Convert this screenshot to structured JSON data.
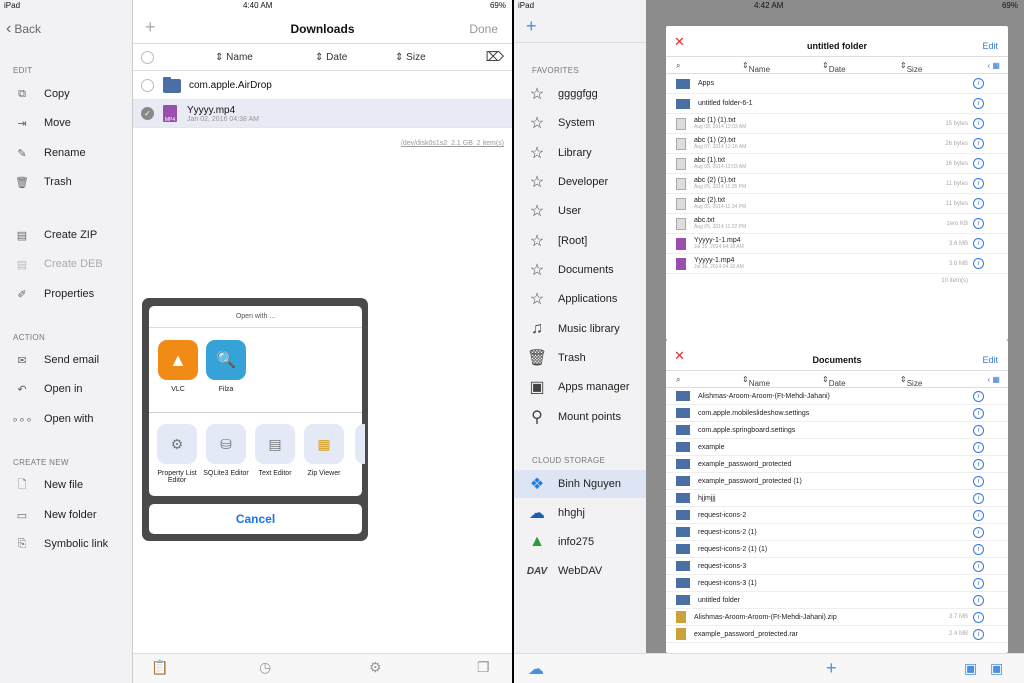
{
  "left": {
    "status": {
      "device": "iPad",
      "time": "4:40 AM",
      "battery": "69%"
    },
    "back": "Back",
    "title": "Downloads",
    "done": "Done",
    "columns": [
      "Name",
      "Date",
      "Size"
    ],
    "sections": {
      "edit": "EDIT",
      "action": "ACTION",
      "create": "CREATE NEW"
    },
    "edit_items": [
      "Copy",
      "Move",
      "Rename",
      "Trash",
      "Create ZIP",
      "Create DEB",
      "Properties"
    ],
    "action_items": [
      "Send email",
      "Open in",
      "Open with"
    ],
    "create_items": [
      "New file",
      "New folder",
      "Symbolic link"
    ],
    "files": [
      {
        "name": "com.apple.AirDrop",
        "sub": ""
      },
      {
        "name": "Yyyyy.mp4",
        "sub": "Jan 02, 2016 04:38 AM"
      }
    ],
    "path": "/dev/disk0s1s2",
    "size": "2.1 GB",
    "items": "2 item(s)",
    "open_with": {
      "title": "Open with ...",
      "apps": [
        "VLC",
        "Filza"
      ],
      "actions": [
        "Property List Editor",
        "SQLite3 Editor",
        "Text Editor",
        "Zip Viewer"
      ],
      "cancel": "Cancel"
    }
  },
  "right": {
    "status": {
      "device": "iPad",
      "time": "4:42 AM",
      "battery": "69%"
    },
    "favorites_label": "FAVORITES",
    "favorites": [
      "ggggfgg",
      "System",
      "Library",
      "Developer",
      "User",
      "[Root]",
      "Documents",
      "Applications",
      "Music library",
      "Trash",
      "Apps manager",
      "Mount points"
    ],
    "cloud_label": "CLOUD STORAGE",
    "cloud": [
      "Binh Nguyen",
      "hhghj",
      "info275",
      "WebDAV"
    ],
    "card1": {
      "title": "untitled folder",
      "edit": "Edit",
      "files": [
        {
          "name": "Apps",
          "sub": "",
          "size": ""
        },
        {
          "name": "untitled folder-6-1",
          "sub": "",
          "size": ""
        },
        {
          "name": "abc (1) (1).txt",
          "sub": "Aug 08, 2014 12:03 AM",
          "size": "15 bytes"
        },
        {
          "name": "abc (1) (2).txt",
          "sub": "Aug 07, 2014 12:16 AM",
          "size": "26 bytes"
        },
        {
          "name": "abc (1).txt",
          "sub": "Aug 05, 2014 12:03 AM",
          "size": "16 bytes"
        },
        {
          "name": "abc (2) (1).txt",
          "sub": "Aug 05, 2014 11:35 PM",
          "size": "11 bytes"
        },
        {
          "name": "abc (2).txt",
          "sub": "Aug 05, 2014 11:34 PM",
          "size": "11 bytes"
        },
        {
          "name": "abc.txt",
          "sub": "Aug 05, 2014 11:22 PM",
          "size": "zero KB"
        },
        {
          "name": "Yyyyy-1-1.mp4",
          "sub": "Jul 16, 2014 04:18 AM",
          "size": "3.6 MB"
        },
        {
          "name": "Yyyyy-1.mp4",
          "sub": "Jul 16, 2014 04:18 AM",
          "size": "3.6 MB"
        }
      ],
      "count": "10 item(s)"
    },
    "card2": {
      "title": "Documents",
      "edit": "Edit",
      "files": [
        "Alishmas-Aroom-Aroom-(Ft-Mehdi-Jahani)",
        "com.apple.mobileslideshow.settings",
        "com.apple.springboard.settings",
        "example",
        "example_password_protected",
        "example_password_protected (1)",
        "hjjmjjj",
        "request-icons-2",
        "request-icons-2 (1)",
        "request-icons-2 (1) (1)",
        "request-icons-3",
        "request-icons-3 (1)",
        "untitled folder",
        "Alishmas-Aroom-Aroom-(Ft-Mehdi-Jahani).zip",
        "example_password_protected.rar"
      ],
      "zip_size": "3.7 MB",
      "rar_size": "2.4 MB"
    }
  }
}
